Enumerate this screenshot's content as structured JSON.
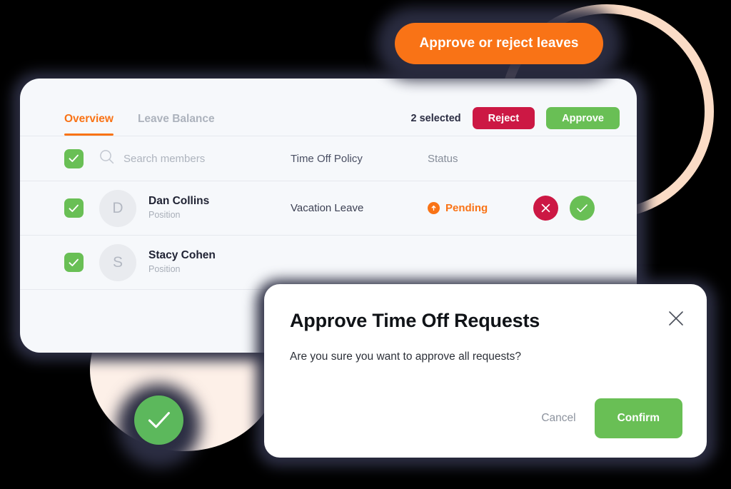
{
  "callout": {
    "label": "Approve or reject leaves"
  },
  "card": {
    "tabs": [
      {
        "label": "Overview",
        "active": true
      },
      {
        "label": "Leave Balance",
        "active": false
      }
    ],
    "toolbar": {
      "selected_count": "2 selected",
      "reject_label": "Reject",
      "approve_label": "Approve"
    },
    "table": {
      "headers": {
        "search_placeholder": "Search members",
        "search_value": "",
        "policy": "Time Off Policy",
        "status": "Status"
      },
      "rows": [
        {
          "checked": true,
          "avatar_initial": "D",
          "name": "Dan Collins",
          "position": "Position",
          "policy": "Vacation Leave",
          "status": "Pending"
        },
        {
          "checked": true,
          "avatar_initial": "S",
          "name": "Stacy Cohen",
          "position": "Position",
          "policy": "",
          "status": ""
        }
      ]
    }
  },
  "modal": {
    "title": "Approve Time Off Requests",
    "body": "Are you sure you want to approve all requests?",
    "cancel_label": "Cancel",
    "confirm_label": "Confirm"
  },
  "colors": {
    "accent_orange": "#f97316",
    "green": "#69bf55",
    "red": "#cc1844",
    "navy": "#2b2d42",
    "peach": "#fbdcc6",
    "card_bg": "#f6f8fb"
  }
}
